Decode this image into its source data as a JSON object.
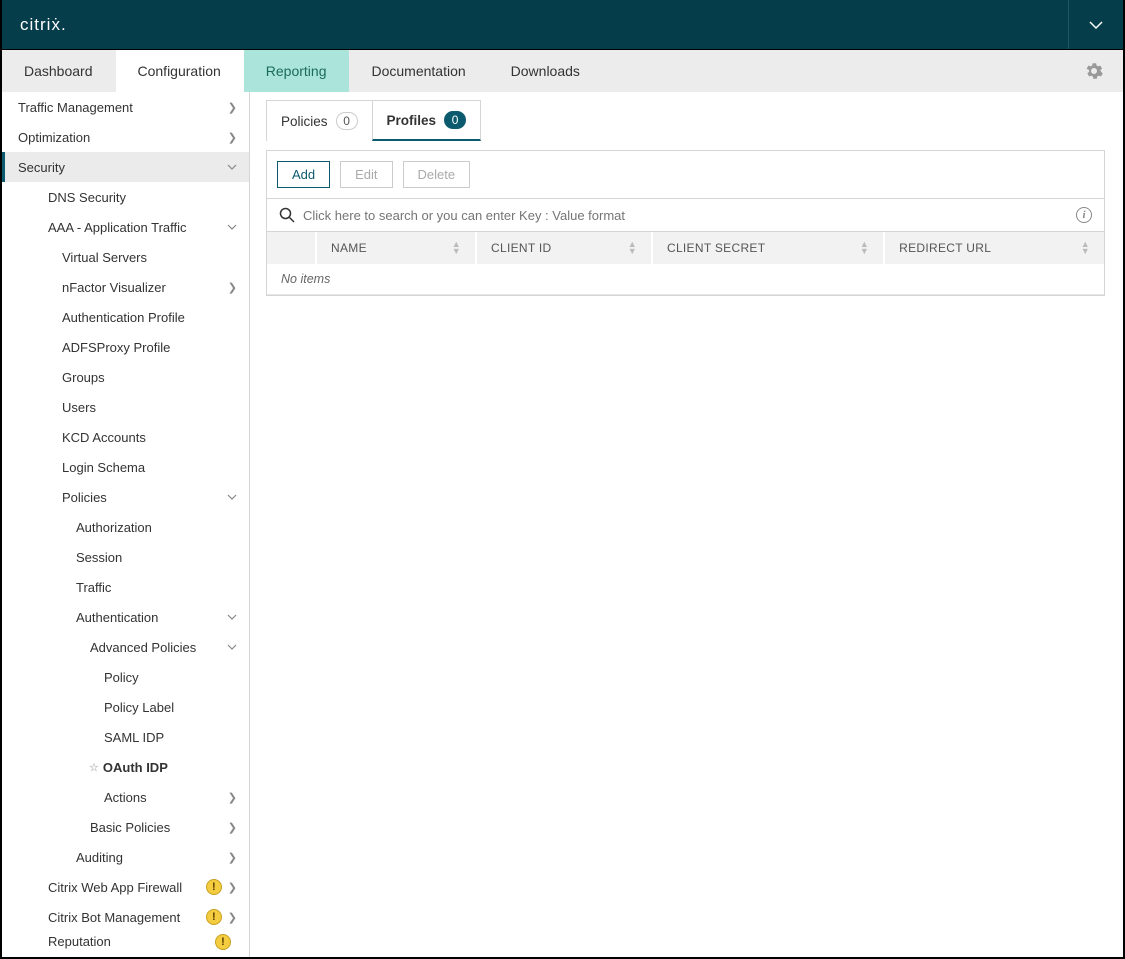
{
  "brand": "citriẋ.",
  "nav": {
    "dashboard": "Dashboard",
    "configuration": "Configuration",
    "reporting": "Reporting",
    "documentation": "Documentation",
    "downloads": "Downloads"
  },
  "sidebar": {
    "traffic_management": "Traffic Management",
    "optimization": "Optimization",
    "security": "Security",
    "dns_security": "DNS Security",
    "aaa": "AAA - Application Traffic",
    "virtual_servers": "Virtual Servers",
    "nfactor": "nFactor Visualizer",
    "auth_profile": "Authentication Profile",
    "adfs_proxy": "ADFSProxy Profile",
    "groups": "Groups",
    "users": "Users",
    "kcd": "KCD Accounts",
    "login_schema": "Login Schema",
    "policies": "Policies",
    "authorization": "Authorization",
    "session": "Session",
    "traffic": "Traffic",
    "authentication": "Authentication",
    "advanced_policies": "Advanced Policies",
    "policy": "Policy",
    "policy_label": "Policy Label",
    "saml_idp": "SAML IDP",
    "oauth_idp": "OAuth IDP",
    "actions": "Actions",
    "basic_policies": "Basic Policies",
    "auditing": "Auditing",
    "waf": "Citrix Web App Firewall",
    "bot": "Citrix Bot Management",
    "reputation": "Reputation"
  },
  "subtabs": {
    "policies": {
      "label": "Policies",
      "count": "0"
    },
    "profiles": {
      "label": "Profiles",
      "count": "0"
    }
  },
  "toolbar": {
    "add": "Add",
    "edit": "Edit",
    "delete": "Delete"
  },
  "search": {
    "placeholder": "Click here to search or you can enter Key : Value format"
  },
  "table": {
    "headers": {
      "name": "NAME",
      "client_id": "CLIENT ID",
      "client_secret": "CLIENT SECRET",
      "redirect_url": "REDIRECT URL"
    },
    "empty": "No items"
  }
}
